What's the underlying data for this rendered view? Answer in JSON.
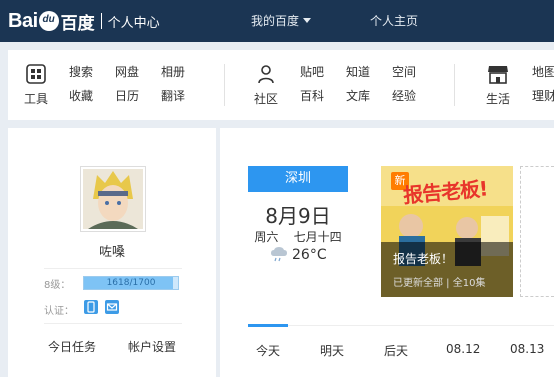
{
  "header": {
    "logo_prefix": "Bai",
    "logo_paw_text": "du",
    "logo_cn": "百度",
    "logo_sub": "个人中心",
    "my_baidu": "我的百度",
    "personal_home": "个人主页"
  },
  "nav": {
    "tools": {
      "label": "工具",
      "icon": "apps-grid-icon",
      "items": [
        "搜索",
        "网盘",
        "相册",
        "收藏",
        "日历",
        "翻译"
      ]
    },
    "community": {
      "label": "社区",
      "icon": "people-icon",
      "items": [
        "贴吧",
        "知道",
        "空间",
        "百科",
        "文库",
        "经验"
      ]
    },
    "life": {
      "label": "生活",
      "icon": "store-icon",
      "items": [
        "地图",
        "理财"
      ]
    }
  },
  "profile": {
    "username": "咗嗓",
    "level_label": "8级：",
    "level_progress": "1618/1700",
    "level_ratio": 0.952,
    "verify_label": "认证：",
    "verify_icons": [
      "phone-icon",
      "mail-icon"
    ],
    "links": [
      "今日任务",
      "帐户设置"
    ]
  },
  "calendar": {
    "city": "深圳",
    "date": "8月9日",
    "weekday_lunar": "周六    七月十四",
    "weather_icon": "cloud-rain-icon",
    "temperature": "26°C"
  },
  "promo": {
    "badge": "新",
    "poster_text": "报告老板!",
    "title": "报告老板！",
    "meta": "已更新全部 | 全10集"
  },
  "tabs": [
    "今天",
    "明天",
    "后天",
    "08.12",
    "08.13"
  ],
  "colors": {
    "topbar": "#1b3553",
    "accent": "#2d96f0"
  }
}
